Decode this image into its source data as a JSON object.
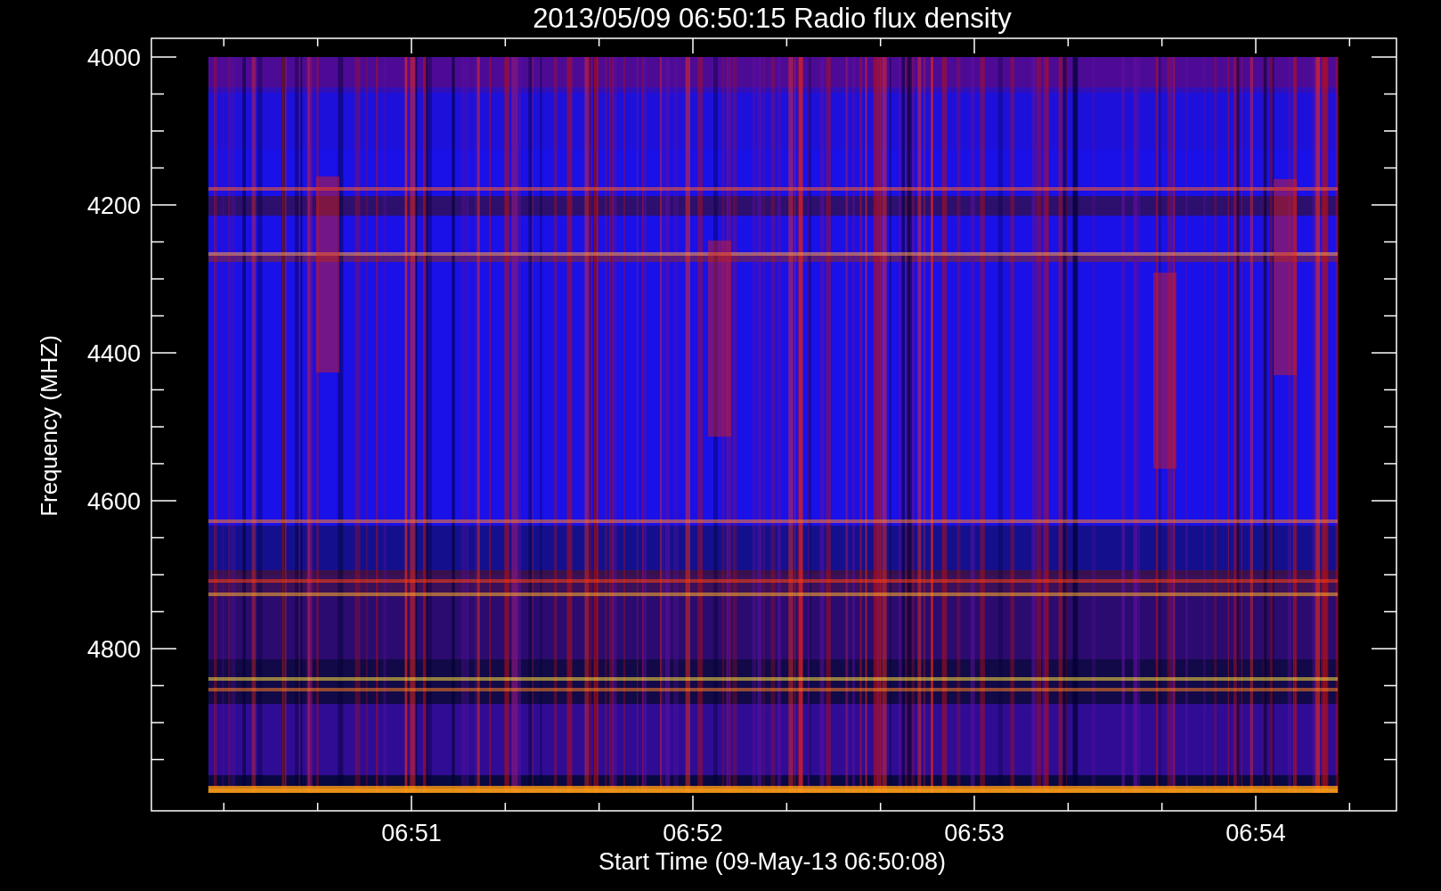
{
  "title": "2013/05/09 06:50:15 Radio flux density",
  "y_axis": {
    "label": "Frequency (MHZ)",
    "ticks": [
      "4000",
      "4200",
      "4400",
      "4600",
      "4800"
    ]
  },
  "x_axis": {
    "label": "Start Time (09-May-13 06:50:08)",
    "ticks": [
      "06:51",
      "06:52",
      "06:53",
      "06:54"
    ]
  }
}
